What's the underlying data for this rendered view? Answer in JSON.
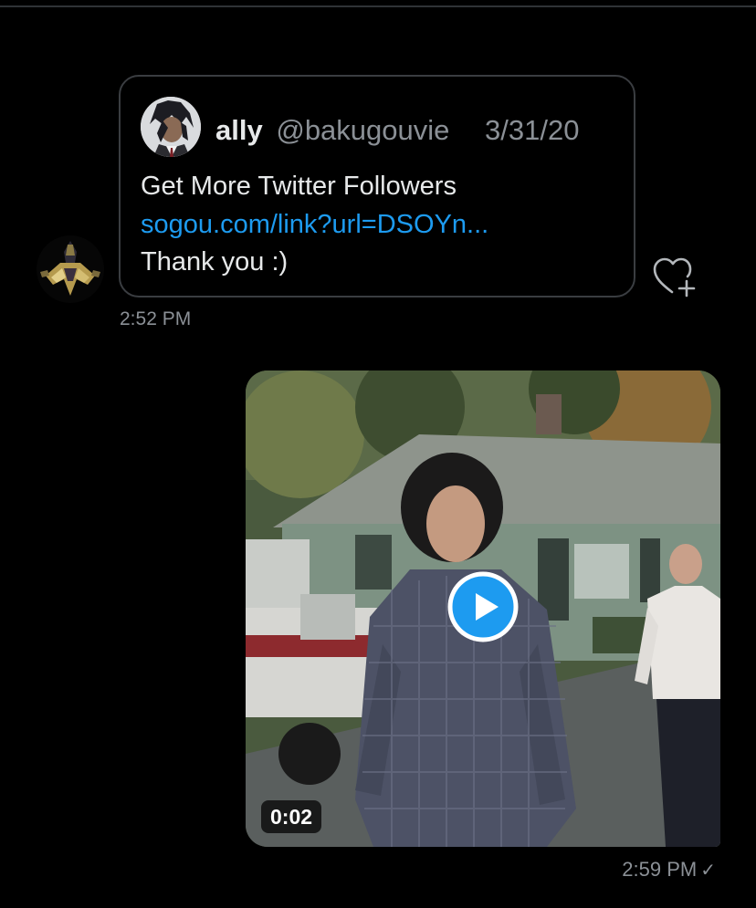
{
  "incoming_message": {
    "quoted_tweet": {
      "author_name": "ally",
      "author_handle": "@bakugouvie",
      "date": "3/31/20",
      "line1": "Get More Twitter Followers",
      "link": "sogou.com/link?url=DSOYn...",
      "line3": "Thank you :)"
    },
    "timestamp": "2:52 PM",
    "react_icon": "heart-plus-icon"
  },
  "outgoing_message": {
    "video_duration": "0:02",
    "timestamp": "2:59 PM",
    "status_icon": "checkmark-icon",
    "status_glyph": "✓",
    "play_icon": "play-icon"
  },
  "colors": {
    "background": "#000000",
    "link": "#1d9bf0",
    "secondary_text": "#8b9096",
    "play_button": "#1d9bf0"
  }
}
